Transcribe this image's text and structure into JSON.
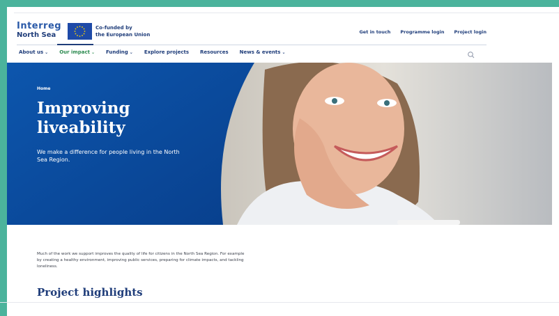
{
  "header": {
    "logo_line1": "Interreg",
    "logo_line2": "North Sea",
    "cofunded_line1": "Co-funded by",
    "cofunded_line2": "the European Union",
    "utility_links": [
      "Get in touch",
      "Programme login",
      "Project login"
    ]
  },
  "nav": {
    "items": [
      {
        "label": "About us",
        "chevron": "⌄"
      },
      {
        "label": "Our impact",
        "chevron": "⌄"
      },
      {
        "label": "Funding",
        "chevron": "⌄"
      },
      {
        "label": "Explore projects",
        "chevron": ""
      },
      {
        "label": "Resources",
        "chevron": ""
      },
      {
        "label": "News & events",
        "chevron": "⌄"
      }
    ],
    "active_index": 1
  },
  "hero": {
    "breadcrumb": "Home",
    "title": "Improving liveability",
    "subtitle": "We make a difference for people living in the North Sea Region.",
    "panel_color": "#0b4ea2"
  },
  "main": {
    "intro": "Much of the work we support improves the quality of life for citizens in the North Sea Region. For example by creating a healthy environment, improving public services, preparing for climate impacts, and tackling loneliness.",
    "section_title": "Project highlights"
  },
  "colors": {
    "frame": "#4bb39c",
    "brand_navy": "#1f3d7a",
    "brand_blue": "#0b4ea2",
    "active_green": "#2b8a4f"
  },
  "icons": {
    "search": "search-icon",
    "eu_flag": "eu-flag-icon"
  }
}
